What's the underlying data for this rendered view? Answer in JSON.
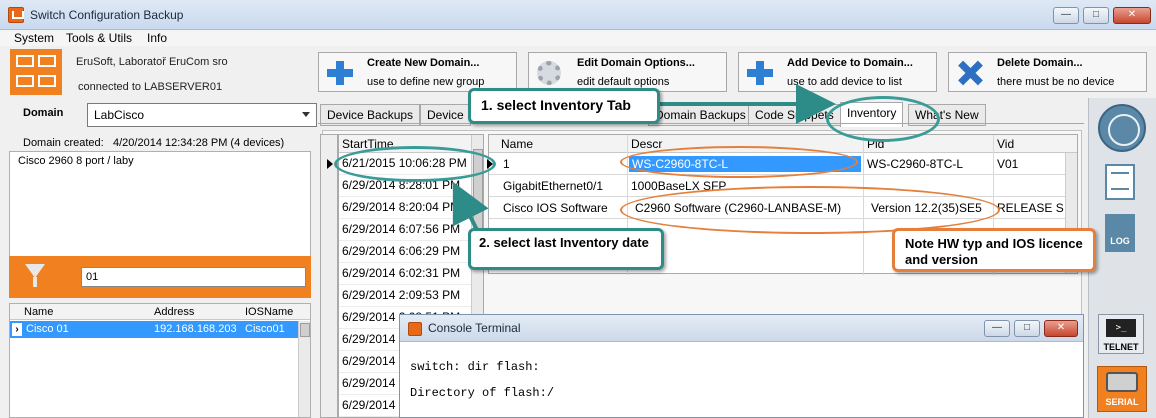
{
  "window": {
    "title": "Switch Configuration Backup"
  },
  "menu": [
    "System",
    "Tools & Utils",
    "Info"
  ],
  "header": {
    "company": "EruSoft, Laboratoř EruCom sro",
    "connected": "connected to LABSERVER01"
  },
  "toolbar": [
    {
      "label": "Create New Domain...",
      "sub": "use to define new group"
    },
    {
      "label": "Edit Domain Options...",
      "sub": "edit default options"
    },
    {
      "label": "Add Device to Domain...",
      "sub": "use to add device to list"
    },
    {
      "label": "Delete Domain...",
      "sub": "there must be no device"
    }
  ],
  "domain": {
    "label": "Domain",
    "value": "LabCisco",
    "created_label": "Domain created:",
    "created_value": "4/20/2014 12:34:28 PM (4 devices)",
    "description": "Cisco 2960 8 port / laby"
  },
  "filter": {
    "value": "01"
  },
  "devices": {
    "columns": [
      "Name",
      "Address",
      "IOSName"
    ],
    "rows": [
      {
        "name": "Cisco 01",
        "address": "192.168.168.203",
        "iosname": "Cisco01"
      }
    ]
  },
  "tabs": [
    "Device Backups",
    "Device",
    "Domain Backups",
    "Code Snippets",
    "Inventory",
    "What's New"
  ],
  "dates": {
    "header": "StartTime",
    "rows": [
      "6/21/2015 10:06:28 PM",
      "6/29/2014 8:28:01 PM",
      "6/29/2014 8:20:04 PM",
      "6/29/2014 6:07:56 PM",
      "6/29/2014 6:06:29 PM",
      "6/29/2014 6:02:31 PM",
      "6/29/2014 2:09:53 PM",
      "6/29/2014 2:08:51 PM",
      "6/29/2014 2:07:43 PM",
      "6/29/2014",
      "6/29/2014",
      "6/29/2014",
      "6/29/2014"
    ]
  },
  "inventory": {
    "columns": [
      "Name",
      "Descr",
      "Pid",
      "Vid"
    ],
    "rows": [
      {
        "name": "1",
        "descr": "WS-C2960-8TC-L",
        "pid": "WS-C2960-8TC-L",
        "vid": "V01"
      },
      {
        "name": "GigabitEthernet0/1",
        "descr": "1000BaseLX SFP",
        "pid": "",
        "vid": ""
      },
      {
        "name": "Cisco IOS Software",
        "descr": "C2960 Software (C2960-LANBASE-M)",
        "pid": "Version 12.2(35)SE5",
        "vid": "RELEASE S"
      }
    ]
  },
  "right_strip": {
    "log": "LOG",
    "telnet": "TELNET",
    "telnet_prompt": ">_",
    "serial": "SERIAL"
  },
  "console": {
    "title": "Console Terminal",
    "lines": [
      "switch: dir flash:",
      "",
      "Directory of flash:/"
    ]
  },
  "callouts": {
    "step1": "1. select Inventory Tab",
    "step2": "2. select last Inventory date",
    "note": "Note HW typ and IOS licence and version"
  },
  "colors": {
    "accent_orange": "#f08020",
    "selection_blue": "#3399ff",
    "callout_teal": "#2e8c88",
    "callout_orange": "#e57f3b"
  }
}
